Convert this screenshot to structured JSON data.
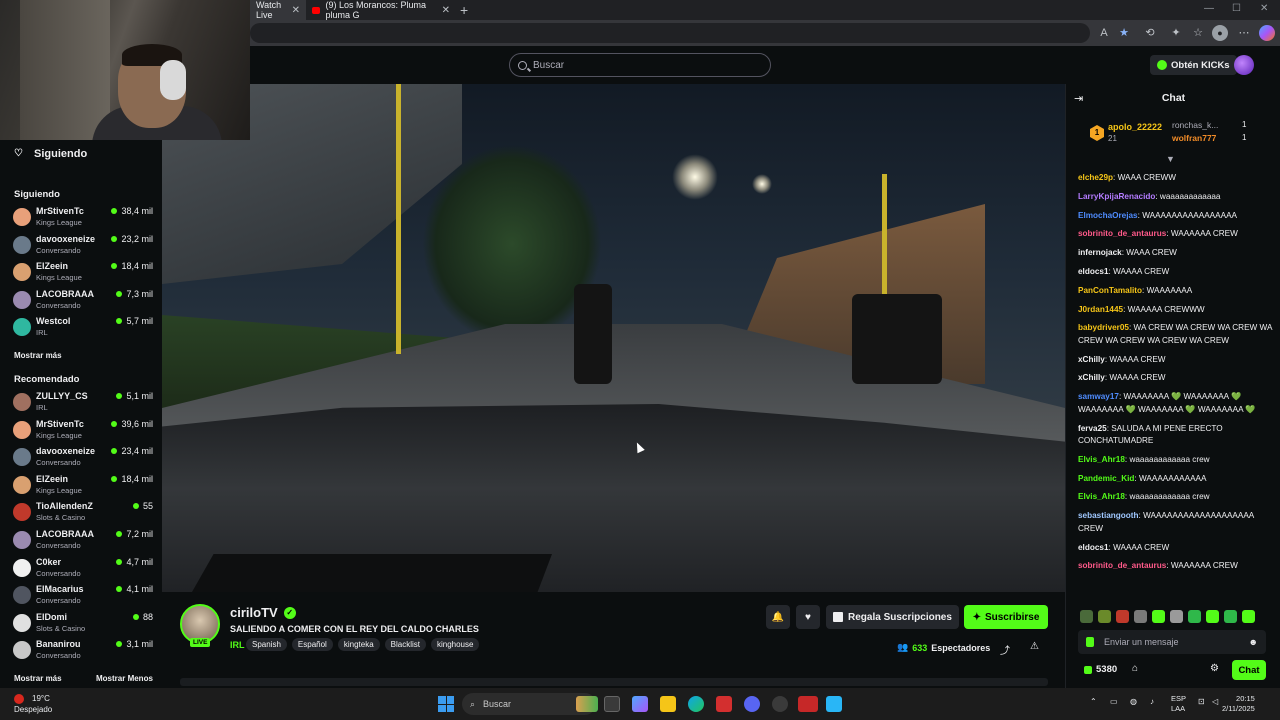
{
  "browser": {
    "tabs": [
      {
        "label": "Watch Live"
      },
      {
        "label": "(9) Los Morancos: Pluma pluma G"
      }
    ],
    "new_tab": "+"
  },
  "topbar": {
    "search_placeholder": "Buscar",
    "kicks_button": "Obtén KICKs"
  },
  "sidebar": {
    "header": "Siguiendo",
    "following_title": "Siguiendo",
    "following": [
      {
        "name": "MrStivenTc",
        "category": "Kings League",
        "viewers": "38,4 mil",
        "color": "#e8a07a"
      },
      {
        "name": "davooxeneize",
        "category": "Conversando",
        "viewers": "23,2 mil",
        "color": "#6a7a8a"
      },
      {
        "name": "ElZeein",
        "category": "Kings League",
        "viewers": "18,4 mil",
        "color": "#d9a070"
      },
      {
        "name": "LACOBRAAA",
        "category": "Conversando",
        "viewers": "7,3 mil",
        "color": "#9a8ab0"
      },
      {
        "name": "Westcol",
        "category": "IRL",
        "viewers": "5,7 mil",
        "color": "#2fb8a0"
      }
    ],
    "show_more_1": "Mostrar más",
    "recommended_title": "Recomendado",
    "recommended": [
      {
        "name": "ZULLYY_CS",
        "category": "IRL",
        "viewers": "5,1 mil",
        "color": "#a07060"
      },
      {
        "name": "MrStivenTc",
        "category": "Kings League",
        "viewers": "39,6 mil",
        "color": "#e8a07a"
      },
      {
        "name": "davooxeneize",
        "category": "Conversando",
        "viewers": "23,4 mil",
        "color": "#6a7a8a"
      },
      {
        "name": "ElZeein",
        "category": "Kings League",
        "viewers": "18,4 mil",
        "color": "#d9a070"
      },
      {
        "name": "TioAllendenZ",
        "category": "Slots & Casino",
        "viewers": "55",
        "color": "#c0392b"
      },
      {
        "name": "LACOBRAAA",
        "category": "Conversando",
        "viewers": "7,2 mil",
        "color": "#9a8ab0"
      },
      {
        "name": "C0ker",
        "category": "Conversando",
        "viewers": "4,7 mil",
        "color": "#f0f0f0"
      },
      {
        "name": "ElMacarius",
        "category": "Conversando",
        "viewers": "4,1 mil",
        "color": "#505560"
      },
      {
        "name": "ElDomi",
        "category": "Slots & Casino",
        "viewers": "88",
        "color": "#e0e0e0"
      },
      {
        "name": "Bananirou",
        "category": "Conversando",
        "viewers": "3,1 mil",
        "color": "#c8c8c8"
      }
    ],
    "show_more_2": "Mostrar más",
    "show_less": "Mostrar Menos"
  },
  "stream": {
    "channel": "ciriloTV",
    "live_badge": "LIVE",
    "title": "SALIENDO A COMER CON EL REY DEL CALDO CHARLES",
    "category": "IRL",
    "tags": [
      "Spanish",
      "Español",
      "kingteka",
      "Blacklist",
      "kinghouse"
    ],
    "gift_button": "Regala Suscripciones",
    "subscribe_button": "Suscribirse",
    "viewers": "633",
    "viewers_label": "Espectadores"
  },
  "chat": {
    "title": "Chat",
    "pinned": {
      "rank": "1",
      "user": "apolo_22222",
      "sub_count": "21",
      "second_user": "ronchas_k...",
      "second_count": "1",
      "third_user": "wolfran777",
      "third_count": "1"
    },
    "messages": [
      {
        "user": "elche29p",
        "color": "#f5c518",
        "text": "WAAA CREWW"
      },
      {
        "user": "LarryKpijaRenacido",
        "color": "#b47cff",
        "text": "waaaaaaaaaaaa"
      },
      {
        "user": "ElmochaOrejas",
        "color": "#4f8cff",
        "text": "WAAAAAAAAAAAAAAAA"
      },
      {
        "user": "sobrinito_de_antaurus",
        "color": "#ff5a8a",
        "text": "WAAAAAA CREW"
      },
      {
        "user": "infernojack",
        "color": "#efeff1",
        "text": "WAAA CREW"
      },
      {
        "user": "eldocs1",
        "color": "#efeff1",
        "text": "WAAAA CREW"
      },
      {
        "user": "PanConTamalito",
        "color": "#f5c518",
        "text": "WAAAAAAA"
      },
      {
        "user": "J0rdan1445",
        "color": "#f5c518",
        "text": "WAAAAA CREWWW"
      },
      {
        "user": "babydriver05",
        "color": "#f5c518",
        "text": "WA CREW WA CREW WA CREW WA CREW WA CREW WA CREW WA CREW"
      },
      {
        "user": "xChilly",
        "color": "#efeff1",
        "text": "WAAAA CREW"
      },
      {
        "user": "xChilly",
        "color": "#efeff1",
        "text": "WAAAA CREW"
      },
      {
        "user": "samway17",
        "color": "#4f8cff",
        "text": "WAAAAAAA 💚 WAAAAAAA 💚 WAAAAAAA 💚 WAAAAAAA 💚 WAAAAAAA 💚"
      },
      {
        "user": "ferva25",
        "color": "#efeff1",
        "text": "SALUDA A MI PENE ERECTO CONCHATUMADRE"
      },
      {
        "user": "Elvis_Ahr18",
        "color": "#53fc18",
        "text": "waaaaaaaaaaaa crew"
      },
      {
        "user": "Pandemic_Kid",
        "color": "#53fc18",
        "text": "WAAAAAAAAAAA"
      },
      {
        "user": "Elvis_Ahr18",
        "color": "#53fc18",
        "text": "waaaaaaaaaaaa crew"
      },
      {
        "user": "sebastiangooth",
        "color": "#a0c8ff",
        "text": "WAAAAAAAAAAAAAAAAAAA CREW"
      },
      {
        "user": "eldocs1",
        "color": "#efeff1",
        "text": "WAAAA CREW"
      },
      {
        "user": "sobrinito_de_antaurus",
        "color": "#ff5a8a",
        "text": "WAAAAAA CREW"
      }
    ],
    "input_placeholder": "Enviar un mensaje",
    "points": "5380",
    "chat_button": "Chat"
  },
  "taskbar": {
    "temp": "19°C",
    "weather": "Despejado",
    "search_placeholder": "Buscar",
    "lang_1": "ESP",
    "lang_2": "LAA",
    "time": "20:15",
    "date": "2/11/2025"
  }
}
